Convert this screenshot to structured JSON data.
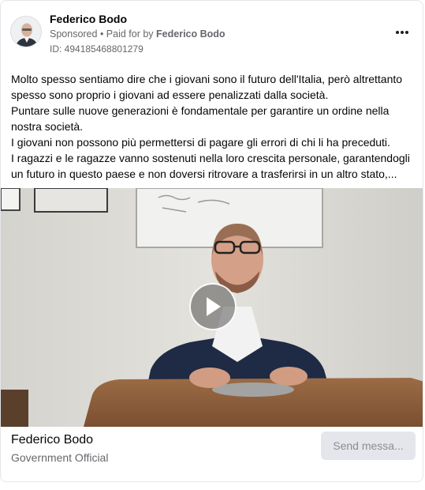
{
  "post": {
    "advertiser_name": "Federico Bodo",
    "sponsored_label": "Sponsored",
    "separator": " • ",
    "paid_for_prefix": "Paid for by ",
    "paid_for_name": "Federico Bodo",
    "library_id": "ID: 494185468801279",
    "more_icon": "more-horizontal-icon",
    "text_lines": [
      "Molto spesso sentiamo dire che i giovani sono il futuro dell'Italia, però altrettanto",
      "spesso sono proprio i giovani ad essere penalizzati dalla società.",
      "Puntare sulle nuove generazioni è fondamentale per garantire un ordine nella",
      "nostra società.",
      "I giovani non possono più permettersi di pagare gli errori di chi li ha preceduti.",
      "I ragazzi e le ragazze vanno sostenuti nella loro crescita personale, garantendogli",
      "un futuro in questo paese e non doversi ritrovare a trasferirsi in un altro stato,..."
    ]
  },
  "media": {
    "type": "video",
    "play_icon": "play-icon"
  },
  "footer": {
    "name": "Federico Bodo",
    "category": "Government Official",
    "cta_label": "Send messa..."
  },
  "colors": {
    "secondary_text": "#65676b",
    "button_bg": "#e4e6eb",
    "button_text": "#8a8d91"
  }
}
